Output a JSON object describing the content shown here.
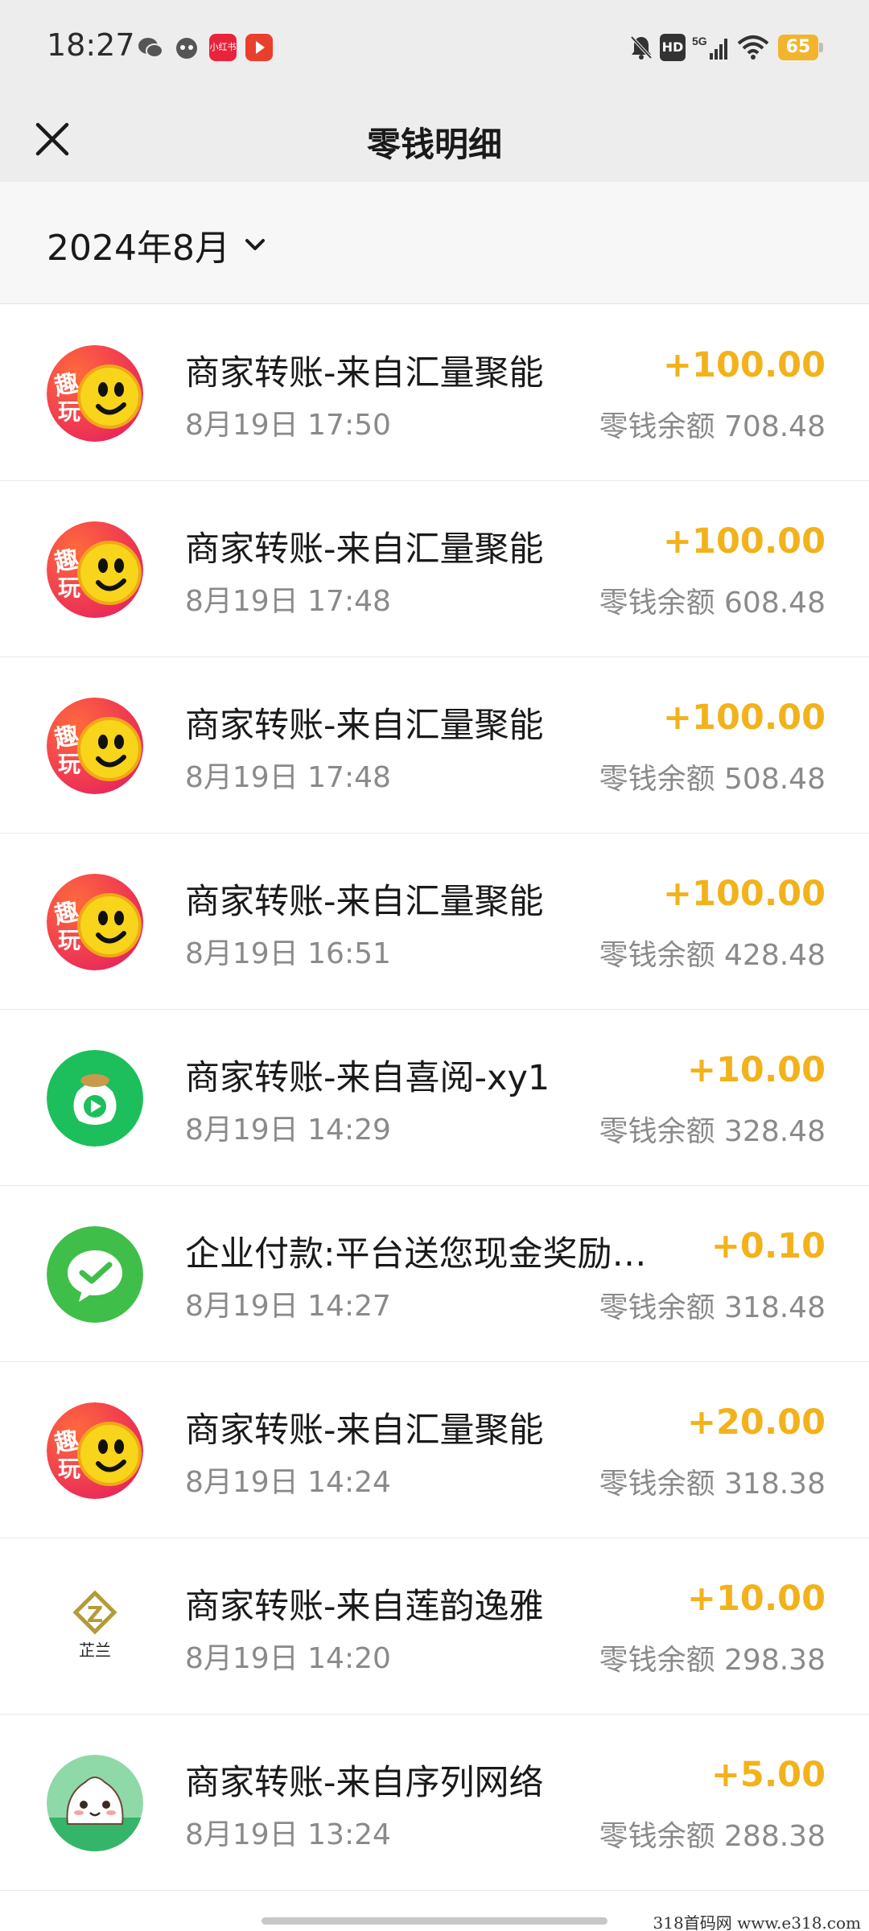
{
  "status_bar": {
    "time": "18:27",
    "xhs_label": "小红书",
    "hd_label": "HD",
    "network": "5G",
    "battery": "65"
  },
  "header": {
    "title": "零钱明细",
    "close_icon": "close-icon"
  },
  "filter": {
    "month": "2024年8月"
  },
  "colors": {
    "amount": "#f2b21b",
    "secondary_text": "#8a8a8a",
    "header_bg": "#ededed"
  },
  "transactions": [
    {
      "title": "商家转账-来自汇量聚能",
      "date": "8月19日 17:50",
      "amount": "+100.00",
      "balance": "零钱余额 708.48",
      "avatar": "quwan",
      "avatar_text": "趣玩"
    },
    {
      "title": "商家转账-来自汇量聚能",
      "date": "8月19日 17:48",
      "amount": "+100.00",
      "balance": "零钱余额 608.48",
      "avatar": "quwan",
      "avatar_text": "趣玩"
    },
    {
      "title": "商家转账-来自汇量聚能",
      "date": "8月19日 17:48",
      "amount": "+100.00",
      "balance": "零钱余额 508.48",
      "avatar": "quwan",
      "avatar_text": "趣玩"
    },
    {
      "title": "商家转账-来自汇量聚能",
      "date": "8月19日 16:51",
      "amount": "+100.00",
      "balance": "零钱余额 428.48",
      "avatar": "quwan",
      "avatar_text": "趣玩"
    },
    {
      "title": "商家转账-来自喜阅-xy1",
      "date": "8月19日 14:29",
      "amount": "+10.00",
      "balance": "零钱余额 328.48",
      "avatar": "xiyue",
      "avatar_text": ""
    },
    {
      "title": "企业付款:平台送您现金奖励…",
      "date": "8月19日 14:27",
      "amount": "+0.10",
      "balance": "零钱余额 318.48",
      "avatar": "wechat",
      "avatar_text": ""
    },
    {
      "title": "商家转账-来自汇量聚能",
      "date": "8月19日 14:24",
      "amount": "+20.00",
      "balance": "零钱余额 318.38",
      "avatar": "quwan",
      "avatar_text": "趣玩"
    },
    {
      "title": "商家转账-来自莲韵逸雅",
      "date": "8月19日 14:20",
      "amount": "+10.00",
      "balance": "零钱余额 298.38",
      "avatar": "zhilan",
      "avatar_text": "芷兰"
    },
    {
      "title": "商家转账-来自序列网络",
      "date": "8月19日 13:24",
      "amount": "+5.00",
      "balance": "零钱余额 288.38",
      "avatar": "bun",
      "avatar_text": ""
    }
  ],
  "watermark": "318首码网 www.e318.com"
}
